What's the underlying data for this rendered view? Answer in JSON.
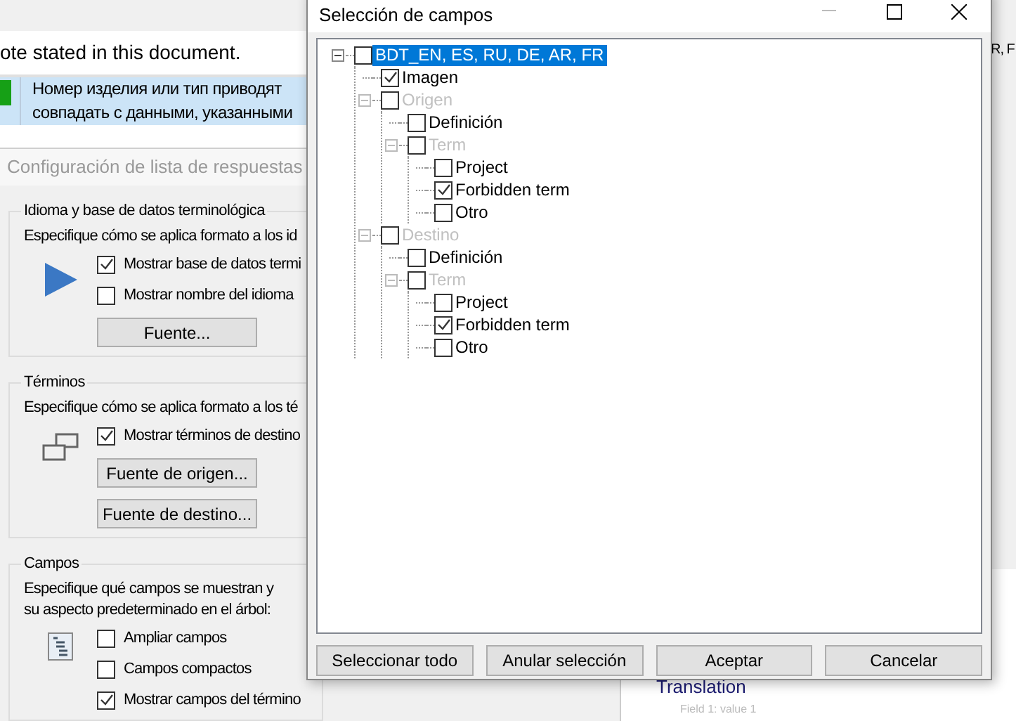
{
  "background": {
    "note": "ote stated in this document.",
    "segment": {
      "lines": [
        "Номер изделия или тип приводят",
        "совпадать с данными, указанными"
      ],
      "color": "#16a016",
      "selected": true
    },
    "panel_title": "Configuración de lista de respuestas",
    "groups": [
      {
        "kind": "language",
        "title": "Idioma y base de datos terminológica",
        "description": [
          "Especifique cómo se aplica formato a los id"
        ],
        "options": [
          {
            "label": "Mostrar base de datos termi",
            "checked": true
          },
          {
            "label": "Mostrar nombre del idioma",
            "checked": false
          }
        ],
        "buttons": [
          "Fuente..."
        ]
      },
      {
        "kind": "terms",
        "title": "Términos",
        "description": [
          "Especifique cómo se aplica formato a los té"
        ],
        "options": [
          {
            "label": "Mostrar términos de destino",
            "checked": true
          }
        ],
        "buttons": [
          "Fuente de origen...",
          "Fuente de destino..."
        ]
      },
      {
        "kind": "fields",
        "title": "Campos",
        "description": [
          "Especifique qué campos se muestran y",
          "su aspecto predeterminado en el árbol:"
        ],
        "options": [
          {
            "label": "Ampliar campos",
            "checked": false
          },
          {
            "label": "Campos compactos",
            "checked": false
          },
          {
            "label": "Mostrar campos del término",
            "checked": true
          }
        ]
      }
    ],
    "right": {
      "cut_text": "R, F",
      "heading": "Translation",
      "field": "Field 1: value 1"
    }
  },
  "dialog": {
    "title": "Selección de campos",
    "tree": [
      {
        "label": "BDT_EN, ES, RU, DE, AR, FR",
        "checked": false,
        "selected": true,
        "disabled": false,
        "expanded": true,
        "children": [
          {
            "label": "Imagen",
            "checked": true,
            "selected": false,
            "disabled": false
          },
          {
            "label": "Origen",
            "checked": false,
            "selected": false,
            "disabled": true,
            "expanded": true,
            "children": [
              {
                "label": "Definición",
                "checked": false,
                "selected": false,
                "disabled": false
              },
              {
                "label": "Term",
                "checked": false,
                "selected": false,
                "disabled": true,
                "expanded": true,
                "children": [
                  {
                    "label": "Project",
                    "checked": false,
                    "selected": false,
                    "disabled": false
                  },
                  {
                    "label": "Forbidden term",
                    "checked": true,
                    "selected": false,
                    "disabled": false
                  },
                  {
                    "label": "Otro",
                    "checked": false,
                    "selected": false,
                    "disabled": false
                  }
                ]
              }
            ]
          },
          {
            "label": "Destino",
            "checked": false,
            "selected": false,
            "disabled": true,
            "expanded": true,
            "children": [
              {
                "label": "Definición",
                "checked": false,
                "selected": false,
                "disabled": false
              },
              {
                "label": "Term",
                "checked": false,
                "selected": false,
                "disabled": true,
                "expanded": true,
                "children": [
                  {
                    "label": "Project",
                    "checked": false,
                    "selected": false,
                    "disabled": false
                  },
                  {
                    "label": "Forbidden term",
                    "checked": true,
                    "selected": false,
                    "disabled": false
                  },
                  {
                    "label": "Otro",
                    "checked": false,
                    "selected": false,
                    "disabled": false
                  }
                ]
              }
            ]
          }
        ]
      }
    ],
    "buttons": [
      "Seleccionar todo",
      "Anular selección",
      "Aceptar",
      "Cancelar"
    ]
  }
}
